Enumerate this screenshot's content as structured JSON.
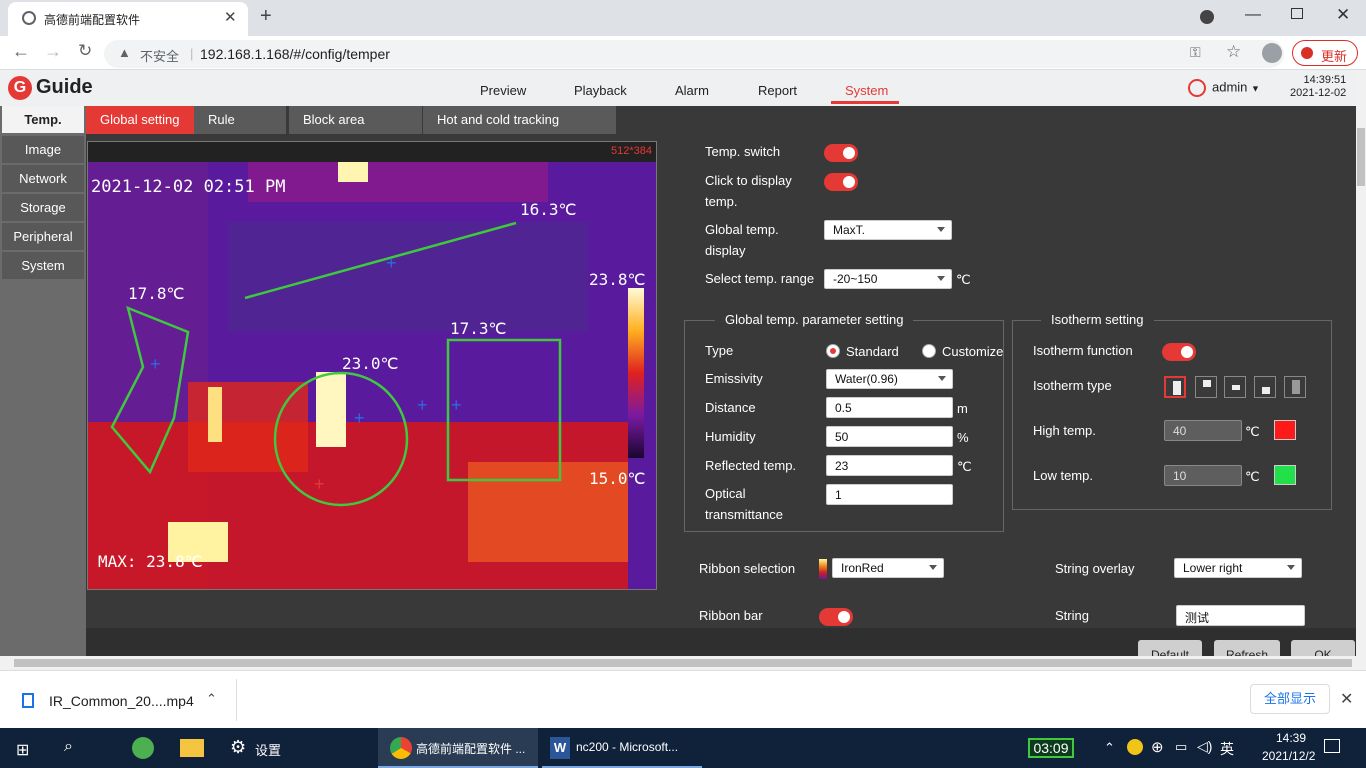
{
  "browser": {
    "tab_title": "高德前端配置软件",
    "security": "不安全",
    "url": "192.168.1.168/#/config/temper",
    "update_label": "更新"
  },
  "header": {
    "logo_text": "Guide",
    "nav": [
      "Preview",
      "Playback",
      "Alarm",
      "Report",
      "System"
    ],
    "active_nav": "System",
    "user": "admin",
    "time": "14:39:51",
    "date": "2021-12-02"
  },
  "sidemenu": [
    "Temp.",
    "Image",
    "Network",
    "Storage",
    "Peripheral",
    "System"
  ],
  "subtabs": [
    "Global setting",
    "Rule setting",
    "Block area settings",
    "Hot and cold tracking settings"
  ],
  "video": {
    "resolution": "512*384",
    "timestamp": "2021-12-02 02:51 PM",
    "line_temp": "16.3℃",
    "polygon_temp": "17.8℃",
    "circle_temp": "23.0℃",
    "rect_temp": "17.3℃",
    "scale_max": "23.8℃",
    "scale_min": "15.0℃",
    "max_label": "MAX: 23.8℃"
  },
  "form": {
    "temp_switch_label": "Temp. switch",
    "click_display_label": "Click to display temp.",
    "global_display_label": "Global temp. display",
    "global_display_value": "MaxT.",
    "range_label": "Select temp. range",
    "range_value": "-20~150",
    "unit_c": "℃",
    "param_group": "Global temp. parameter setting",
    "type_label": "Type",
    "type_standard": "Standard",
    "type_customize": "Customize",
    "emissivity_label": "Emissivity",
    "emissivity_value": "Water(0.96)",
    "distance_label": "Distance",
    "distance_value": "0.5",
    "distance_unit": "m",
    "humidity_label": "Humidity",
    "humidity_value": "50",
    "humidity_unit": "%",
    "reflected_label": "Reflected temp.",
    "reflected_value": "23",
    "optical_label": "Optical transmittance",
    "optical_value": "1",
    "iso_group": "Isotherm setting",
    "iso_function_label": "Isotherm function",
    "iso_type_label": "Isotherm type",
    "high_temp_label": "High temp.",
    "high_temp_value": "40",
    "high_color": "#ff1a1a",
    "low_temp_label": "Low temp.",
    "low_temp_value": "10",
    "low_color": "#22e04a",
    "ribbon_label": "Ribbon selection",
    "ribbon_value": "IronRed",
    "ribbon_bar_label": "Ribbon bar",
    "string_overlay_label": "String overlay",
    "string_overlay_value": "Lower right",
    "string_label": "String",
    "string_value": "测试",
    "buttons": [
      "Default",
      "Refresh",
      "OK"
    ]
  },
  "download": {
    "file": "IR_Common_20....mp4",
    "show_all": "全部显示"
  },
  "taskbar": {
    "settings": "设置",
    "chrome_task": "高德前端配置软件 ...",
    "word_task": "nc200 - Microsoft...",
    "timer": "03:09",
    "ime": "英",
    "time": "14:39",
    "date": "2021/12/2"
  }
}
